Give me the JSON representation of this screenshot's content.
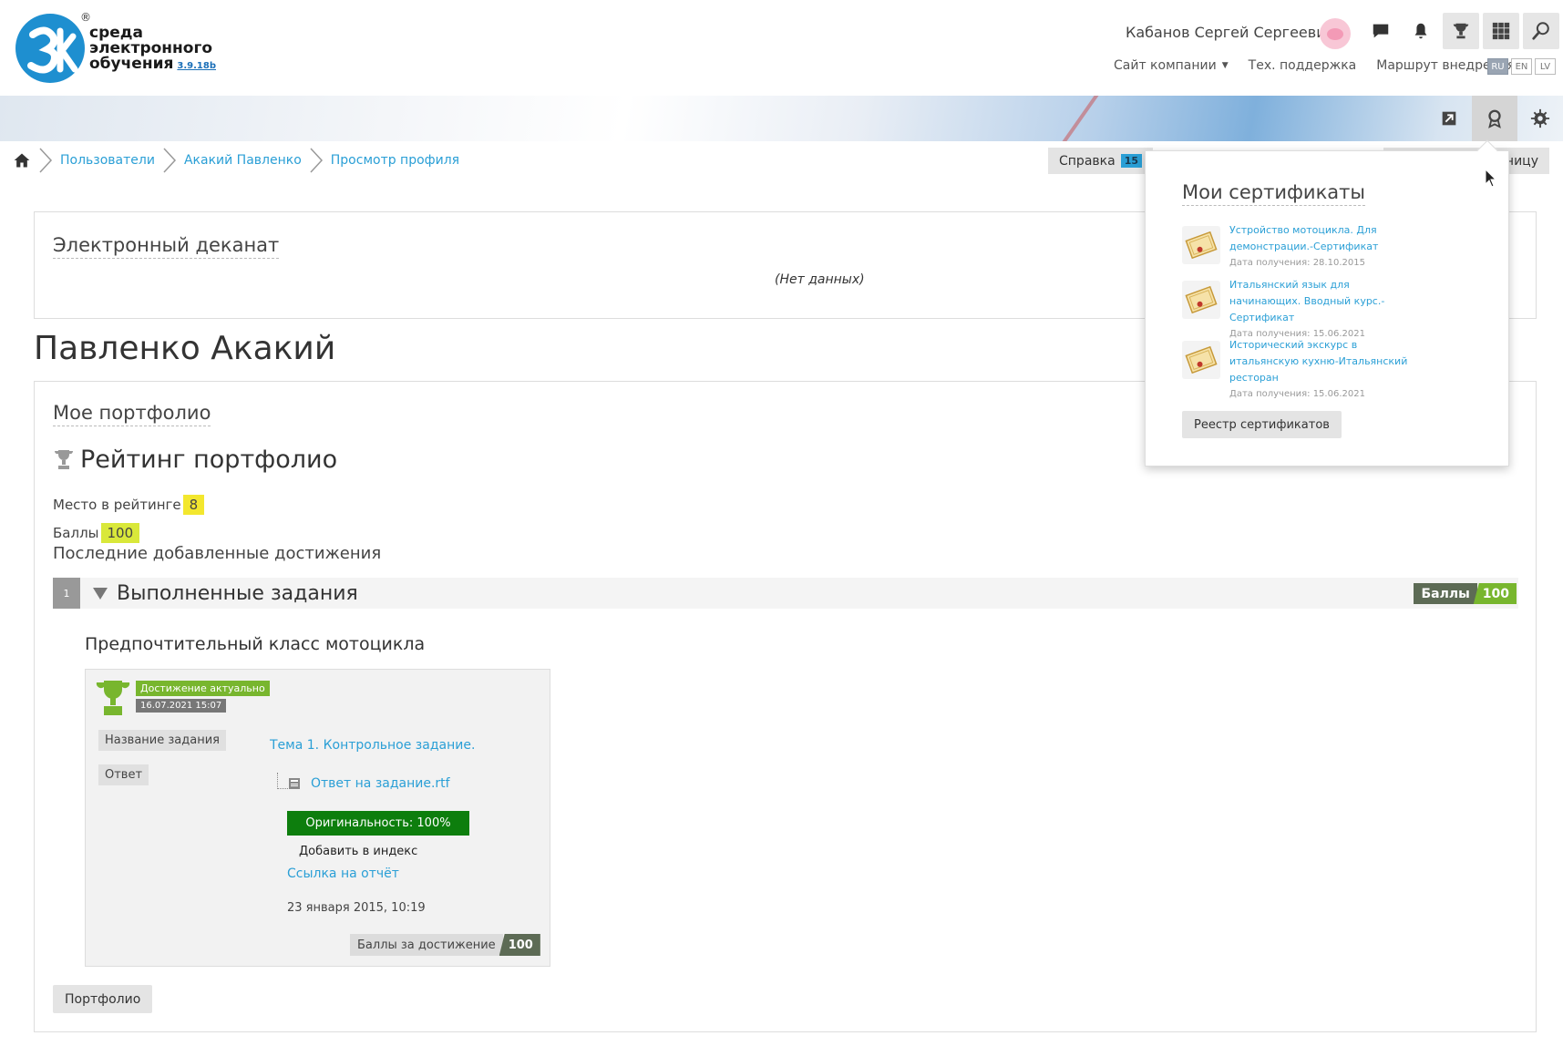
{
  "header": {
    "logo": {
      "mark": "3k",
      "line1": "среда",
      "line2": "электронного",
      "line3": "обучения",
      "version": "3.9.18b",
      "registered": "®"
    },
    "user_name": "Кабанов Сергей Сергеевич",
    "nav": {
      "company_site": "Сайт компании",
      "support": "Тех. поддержка",
      "route": "Маршрут внедрения"
    },
    "langs": [
      "RU",
      "EN",
      "LV"
    ],
    "active_lang": "RU",
    "icons": [
      "chat-icon",
      "bell-icon",
      "trophy-icon",
      "apps-grid-icon",
      "search-icon"
    ]
  },
  "banner": {
    "icons": [
      "send-icon",
      "certificate-icon",
      "settings-icon"
    ],
    "active_icon": "certificate-icon"
  },
  "breadcrumb": {
    "items": [
      "Пользователи",
      "Акакий Павленко",
      "Просмотр профиля"
    ]
  },
  "actions": {
    "help_label": "Справка",
    "help_badge": "15",
    "partial_button": "ницу"
  },
  "dean": {
    "title": "Электронный деканат",
    "no_data": "(Нет данных)"
  },
  "page_title": "Павленко Акакий",
  "portfolio": {
    "title": "Мое портфолио",
    "rating_title": "Рейтинг портфолио",
    "place_label": "Место в рейтинге",
    "place_value": "8",
    "points_label": "Баллы",
    "points_value": "100",
    "recent_label": "Последние добавленные достижения",
    "section": {
      "number": "1",
      "title": "Выполненные задания",
      "badge_label": "Баллы",
      "badge_value": "100"
    },
    "achievement": {
      "heading": "Предпочтительный класс мотоцикла",
      "status_tag": "Достижение актуально",
      "date_tag": "16.07.2021 15:07",
      "task_label": "Название задания",
      "task_value": "Тема 1. Контрольное задание.",
      "answer_label": "Ответ",
      "answer_file": "Ответ на задание.rtf",
      "originality": "Оригинальность: 100%",
      "add_index": "Добавить в индекс",
      "report_link": "Ссылка на отчёт",
      "date": "23 января 2015, 10:19",
      "score_label": "Баллы за достижение",
      "score_value": "100"
    },
    "button": "Портфолио"
  },
  "certificates": {
    "title": "Мои сертификаты",
    "items": [
      {
        "name": "Устройство мотоцикла. Для демонстрации.-Сертификат",
        "date": "Дата получения: 28.10.2015"
      },
      {
        "name": "Итальянский язык для начинающих. Вводный курс.-Сертификат",
        "date": "Дата получения: 15.06.2021"
      },
      {
        "name": "Исторический экскурс в итальянскую кухню-Итальянский ресторан",
        "date": "Дата получения: 15.06.2021"
      }
    ],
    "registry_button": "Реестр сертификатов"
  },
  "colors": {
    "link": "#2a9fd6",
    "accent_green": "#78b62e",
    "originality_green": "#0d7e0d",
    "highlight_yellow": "#f3e72e",
    "badge_dark": "#5d6b55"
  }
}
